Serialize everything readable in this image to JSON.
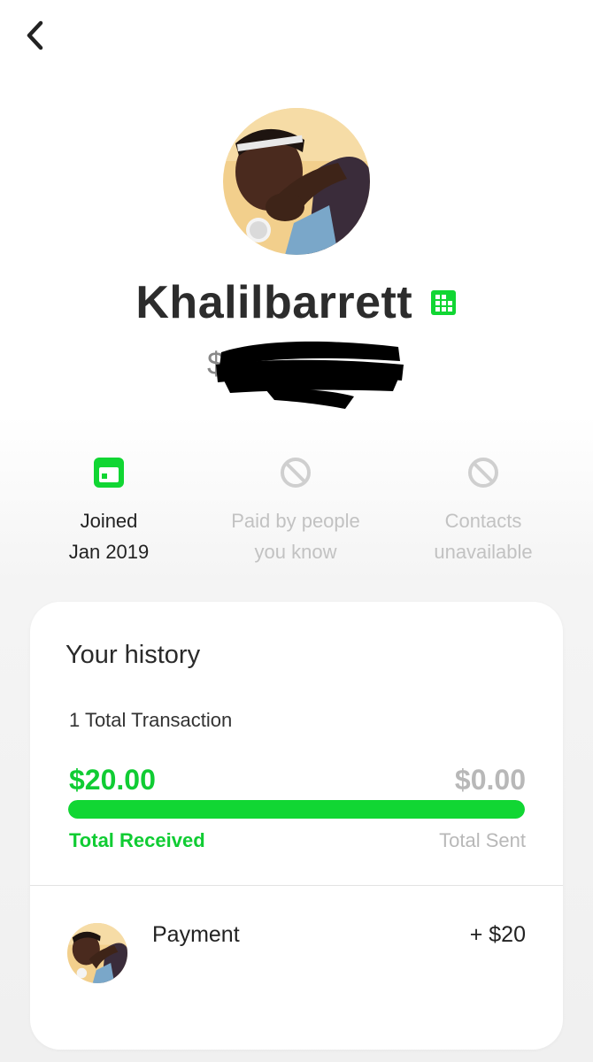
{
  "header": {
    "back_icon": "chevron-left-icon"
  },
  "profile": {
    "name": "Khalilbarrett",
    "name_badge_icon": "business-icon",
    "cashtag_prefix": "$",
    "cashtag_redacted": true,
    "avatar": "profile-photo"
  },
  "stats": [
    {
      "icon": "calendar-icon",
      "line1": "Joined",
      "line2": "Jan 2019",
      "active": true
    },
    {
      "icon": "prohibited-icon",
      "line1": "Paid by people",
      "line2": "you know",
      "active": false
    },
    {
      "icon": "prohibited-icon",
      "line1": "Contacts",
      "line2": "unavailable",
      "active": false
    }
  ],
  "history": {
    "title": "Your history",
    "transaction_count": "1 Total Transaction",
    "received_amount": "$20.00",
    "sent_amount": "$0.00",
    "received_label": "Total Received",
    "sent_label": "Total Sent",
    "received_fraction": 1.0
  },
  "transactions": [
    {
      "title": "Payment",
      "amount": "+ $20",
      "avatar": "profile-photo"
    }
  ],
  "colors": {
    "accent_green": "#11d633",
    "muted_text": "#c2c2c2",
    "card_bg": "#ffffff"
  }
}
